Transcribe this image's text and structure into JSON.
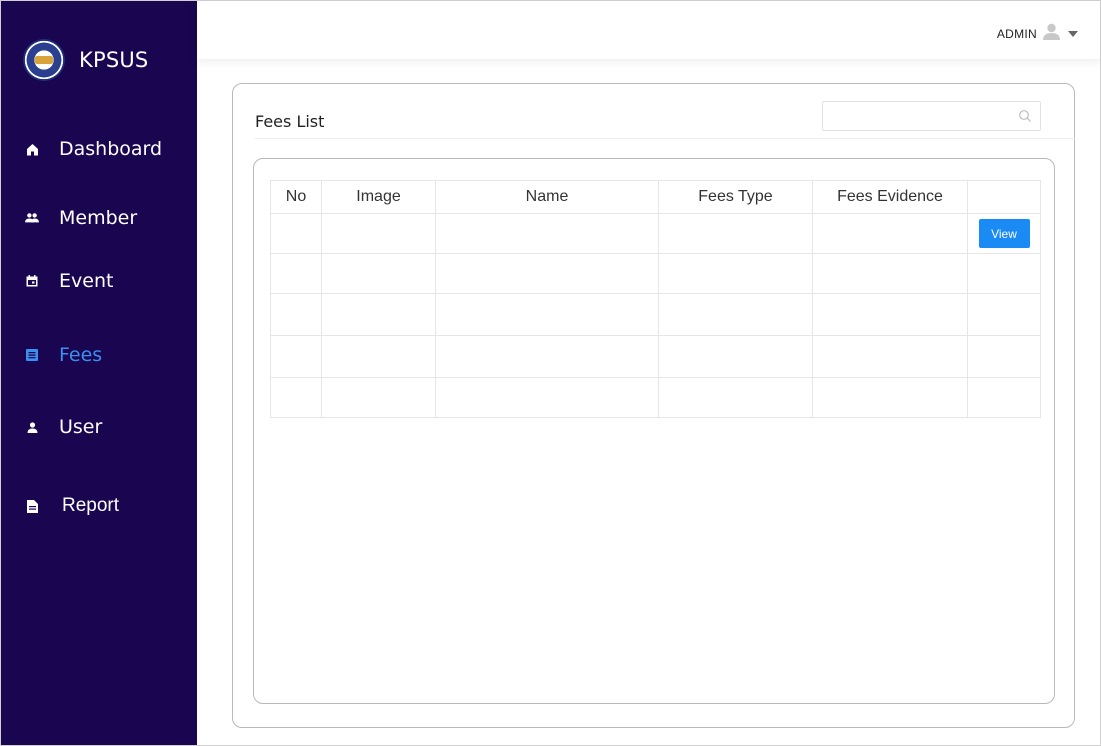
{
  "brand": {
    "name": "KPSUS",
    "logo": "kpsus-logo"
  },
  "colors": {
    "sidebar_bg": "#1a0550",
    "active": "#3b8ff0",
    "button": "#1a8bf5"
  },
  "sidebar": {
    "items": [
      {
        "label": "Dashboard",
        "icon": "home-icon",
        "active": false
      },
      {
        "label": "Member",
        "icon": "group-icon",
        "active": false
      },
      {
        "label": "Event",
        "icon": "calendar-icon",
        "active": false
      },
      {
        "label": "Fees",
        "icon": "list-icon",
        "active": true
      },
      {
        "label": "User",
        "icon": "person-icon",
        "active": false
      },
      {
        "label": "Report",
        "icon": "file-icon",
        "active": false
      }
    ]
  },
  "header": {
    "user_label": "ADMIN",
    "user_icon": "user-avatar-icon",
    "menu_icon": "caret-down-icon"
  },
  "page": {
    "title": "Fees List",
    "search": {
      "placeholder": "",
      "value": "",
      "icon": "search-icon"
    }
  },
  "table": {
    "columns": [
      "No",
      "Image",
      "Name",
      "Fees Type",
      "Fees Evidence",
      ""
    ],
    "rows": [
      [
        "",
        "",
        "",
        "",
        "",
        "View"
      ],
      [
        "",
        "",
        "",
        "",
        "",
        ""
      ],
      [
        "",
        "",
        "",
        "",
        "",
        ""
      ],
      [
        "",
        "",
        "",
        "",
        "",
        ""
      ],
      [
        "",
        "",
        "",
        "",
        "",
        ""
      ]
    ]
  }
}
